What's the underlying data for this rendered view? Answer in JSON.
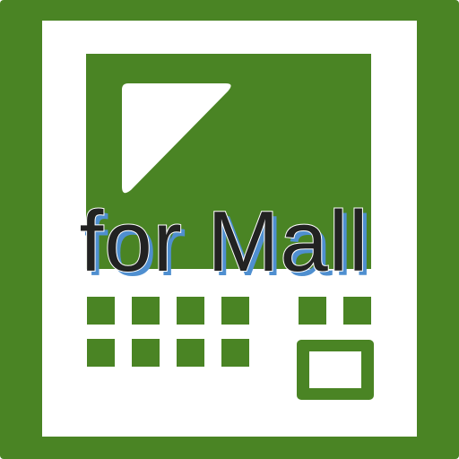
{
  "icon": {
    "name": "pos-terminal-icon",
    "label": "for Mall",
    "colors": {
      "frame": "#4a8424",
      "background": "#ffffff",
      "screen": "#4a8424",
      "keys": "#4a8424",
      "label_fill": "#222222",
      "label_shadow": "#4f8fd0",
      "label_outline": "#ffffff"
    }
  }
}
